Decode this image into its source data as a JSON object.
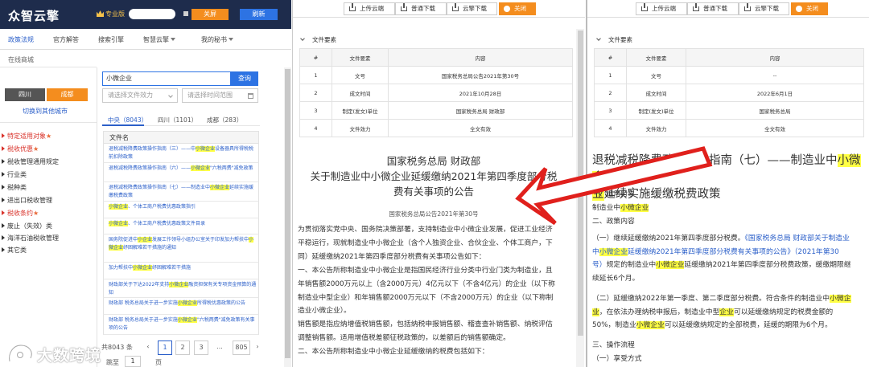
{
  "app": {
    "logo": "众智云擎",
    "pro_label": "专业版",
    "close_label": "关屏",
    "refresh_label": "刷新"
  },
  "nav": {
    "tabs": [
      "政策法规",
      "官方解答",
      "搜索引擎",
      "智慧云擎",
      "我的秘书"
    ]
  },
  "sidebar": {
    "mall_label": "在线商城",
    "city_left": "四川",
    "city_right": "成都",
    "switch_city": "切换到其他城市",
    "categories": [
      {
        "label": "特定适用对象",
        "star": "★",
        "red": true
      },
      {
        "label": "税收优惠",
        "star": "★",
        "red": true
      },
      {
        "label": "税收管理通用规定",
        "red": false
      },
      {
        "label": "行业类",
        "red": false
      },
      {
        "label": "税种类",
        "red": false
      },
      {
        "label": "进出口税收管理",
        "red": false
      },
      {
        "label": "税收条约",
        "star": "★",
        "red": true
      },
      {
        "label": "废止（失效）类",
        "red": false
      },
      {
        "label": "海洋石油税收管理",
        "red": false
      },
      {
        "label": "其它类",
        "red": false
      }
    ]
  },
  "search": {
    "query": "小微企业",
    "button": "查询",
    "select1_placeholder": "请选择文件效力",
    "select2_placeholder": "请选择时间范围",
    "tabs": [
      "中央（8043）",
      "四川（1101）",
      "成都（283）"
    ]
  },
  "results": {
    "header": "文件名",
    "items": [
      {
        "parts": [
          "退税减税降费政策操作指南（三）——中",
          "小微企业",
          "设备器具所得税税前扣除政策"
        ]
      },
      {
        "parts": [
          "退税减税降费政策操作指南（六）——",
          "小微企业",
          "\"六税两费\"减免政策"
        ]
      },
      {
        "parts": [
          "退税减税降费政策操作指南（七）——制造业中",
          "小微企业",
          "延续实施缓缴税费政策"
        ]
      },
      {
        "parts": [
          "",
          "小微企业",
          "、个体工商户税费优惠政策指引"
        ]
      },
      {
        "parts": [
          "",
          "小微企业",
          "、个体工商户税费优惠政策文件目录"
        ]
      },
      {
        "parts": [
          "国务院促进中",
          "小企业",
          "发展工作领导小组办公室关于印发加力帮扶中",
          "小微企业",
          "纾困解难若干措施的通知"
        ]
      },
      {
        "parts": [
          "加力帮扶中",
          "小微企业",
          "纾困解难若干措施"
        ]
      },
      {
        "parts": [
          "财政部关于下达2022年支持",
          "小微企业",
          "融资担保有关专项资金预算的通知"
        ]
      },
      {
        "parts": [
          "财政部 税务总局关于进一步实施",
          "小微企业",
          "所得税优惠政策的公告"
        ]
      },
      {
        "parts": [
          "财政部 税务总局关于进一步实施",
          "小微企业",
          "\"六税两费\"减免政策有关事项的公告"
        ]
      }
    ]
  },
  "pager": {
    "total_prefix": "共",
    "total": "8043",
    "per_unit": "条",
    "pages": [
      "1",
      "2",
      "3",
      "...",
      "805"
    ],
    "goto_label": "跳至",
    "goto_value": "1",
    "page_unit": "页"
  },
  "watermark": "大数跨境",
  "viewer": {
    "buttons": [
      "上传云端",
      "普通下载",
      "云擎下载"
    ],
    "close": "关闭",
    "section": "文件要素",
    "col_no": "#",
    "col_key": "文件要素",
    "col_val": "内容"
  },
  "doc_mid": {
    "rows": [
      {
        "no": "1",
        "key": "文号",
        "val": "国家税务总局公告2021年第30号"
      },
      {
        "no": "2",
        "key": "成文时间",
        "val": "2021年10月28日"
      },
      {
        "no": "3",
        "key": "制定(发文)单位",
        "val": "国家税务总局 财政部"
      },
      {
        "no": "4",
        "key": "文件效力",
        "val": "全文有效"
      }
    ],
    "title_line1": "国家税务总局 财政部",
    "title_line2": "关于制造业中小微企业延缓缴纳2021年第四季度部分税",
    "title_line3": "费有关事项的公告",
    "subtitle": "国家税务总局公告2021年第30号",
    "paragraphs": [
      "为贯彻落实党中央、国务院决策部署，支持制造业中小微企业发展，促进工业经济",
      "平稳运行，现就制造业中小微企业（含个人独资企业、合伙企业、个体工商户，下",
      "同）延缓缴纳2021年第四季度部分税费有关事项公告如下：",
      "一、本公告所称制造业中小微企业是指国民经济行业分类中行业门类为制造业，且",
      "年销售额2000万元以上（含2000万元）4亿元以下（不含4亿元）的企业（以下称",
      "制造业中型企业）和年销售额2000万元以下（不含2000万元）的企业（以下称制",
      "造业小微企业）。",
      "销售额是指应纳增值税销售额，包括纳税申报销售额、稽查查补销售额、纳税评估",
      "调整销售额。适用增值税差额征税政策的，以差额后的销售额确定。",
      "二、本公告所称制造业中小微企业延缓缴纳的税费包括如下："
    ]
  },
  "doc_right": {
    "rows": [
      {
        "no": "1",
        "key": "文号",
        "val": "--"
      },
      {
        "no": "2",
        "key": "成文时间",
        "val": "2022年6月1日"
      },
      {
        "no": "3",
        "key": "制定(发文)单位",
        "val": "国家税务总局"
      },
      {
        "no": "4",
        "key": "文件效力",
        "val": "全文有效"
      }
    ],
    "title_pre": "退税减税降费政策操作指南（七）——制造业中",
    "title_hl1": "小微企",
    "title_hl2": "业",
    "title_post": "延续实施缓缴税费政策",
    "s1": "一、适用对象",
    "s1_line_pre": "制造业中",
    "s1_line_hl": "小微企业",
    "s2": "二、政策内容",
    "p1a": "（一）继续延缓缴纳2021年第四季度部分税费。",
    "p1b": "《国家税务总局 财政部关于制造业",
    "p1c": "中",
    "p1d": "小微企业",
    "p1e": "延缓缴纳2021年第四季度部分税费有关事项的公告》（2021年第30",
    "p1f": "号）",
    "p1g": "规定的制造业中",
    "p1h": "小微企业",
    "p1i": "延缓缴纳2021年第四季度部分税费政策，缓缴期限继",
    "p1j": "续延长6个月。",
    "p2a": "（二）延缓缴纳2022年第一季度、第二季度部分税费。符合条件的制造业中",
    "p2b": "小微企",
    "p2c": "业",
    "p2d": "，在依法办理纳税申报后，制造业中型",
    "p2e": "企业",
    "p2f": "可以延缓缴纳规定的税费金额的",
    "p2g": "50%，制造业",
    "p2h": "小微企业",
    "p2i": "可以延缓缴纳规定的全部税费，延缓的期限为6个月。",
    "s3": "三、操作流程",
    "s3a": "（一）享受方式"
  },
  "colors": {
    "topbar": "#1e2c4c",
    "orange": "#f48d1e",
    "blue": "#2d73e3",
    "highlight": "#ffff44",
    "arrow": "#e0201c"
  }
}
